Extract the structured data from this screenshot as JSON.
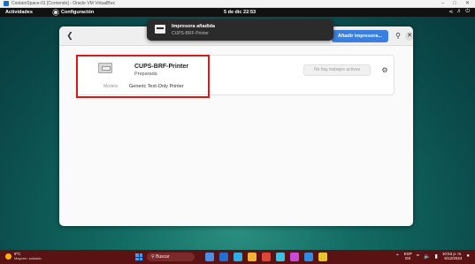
{
  "vm": {
    "title": "ContainSpace-01 [Corriendo] - Oracle VM VirtualBox",
    "controls": [
      "–",
      "□",
      "✕"
    ]
  },
  "topbar": {
    "activities": "Actividades",
    "app": "Configuración",
    "clock": "5 de dic  22:53",
    "status_icons": [
      "network-icon",
      "volume-icon",
      "power-icon"
    ]
  },
  "settings_window": {
    "add_printer_label": "Añadir impresora...",
    "printer": {
      "name": "CUPS-BRF-Printer",
      "state": "Preparada",
      "model_label": "Modelo",
      "model_value": "Generic Text-Only Printer",
      "jobs_label": "No hay trabajos activos"
    }
  },
  "notification": {
    "title": "Impresora añadida",
    "body": "CUPS-BRF-Printer"
  },
  "taskbar": {
    "weather_temp": "9°C",
    "weather_desc": "Mayorm. soleado",
    "search_label": "Buscar",
    "lang_top": "ESP",
    "lang_bottom": "ES",
    "time": "10:53 p. m.",
    "date": "5/12/2024",
    "app_icon_colors": [
      "#4a90e2",
      "#1f6fd6",
      "#2ab0e6",
      "#f2b233",
      "#e0453a",
      "#3ac0e0",
      "#c64bd8",
      "#2d8de6",
      "#e6c52a"
    ]
  },
  "colors": {
    "accent": "#3a7fe0",
    "highlight": "#e01515",
    "taskbar": "#5b1212"
  }
}
